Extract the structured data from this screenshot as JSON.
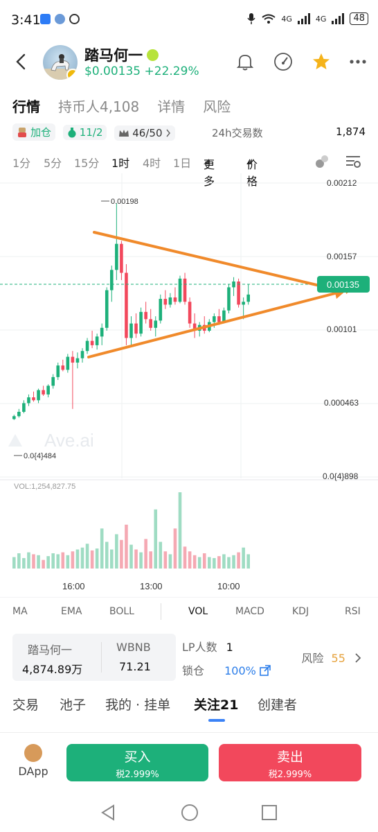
{
  "status_bar": {
    "time": "3:41",
    "network_labels": [
      "4G",
      "4G"
    ],
    "battery": "48"
  },
  "header": {
    "token_name": "踏马何一",
    "price": "$0.00135",
    "change": "+22.29%"
  },
  "tabs": [
    {
      "label": "行情"
    },
    {
      "label": "持币人4,108"
    },
    {
      "label": "详情"
    },
    {
      "label": "风险"
    }
  ],
  "stats": {
    "add_position_label": "加仓",
    "holders_ratio": "11/2",
    "crown_ratio": "46/50",
    "tx_label": "24h交易数",
    "tx_value": "1,874"
  },
  "intervals": {
    "items": [
      "1分",
      "5分",
      "15分",
      "1时",
      "4时",
      "1日"
    ],
    "more_label": "更多",
    "price_label": "价格"
  },
  "chart_data": {
    "type": "candlestick",
    "price_axis_labels": [
      "0.00212",
      "0.00157",
      "0.00101",
      "0.000463",
      "0.0{4}898"
    ],
    "current_price_tag": "0.00135",
    "high_annotation": "0.00198",
    "low_annotation": "0.0{4}484",
    "time_ticks": [
      "16:00",
      "13:00",
      "10:00"
    ],
    "watermark": "Ave.ai",
    "volume_label": "VOL:1,254,827.75",
    "ylim": [
      8.98e-05,
      0.00212
    ],
    "candles": [
      {
        "o": 0.00049,
        "h": 0.00052,
        "l": 0.000484,
        "c": 0.00051
      },
      {
        "o": 0.00051,
        "h": 0.00056,
        "l": 0.0005,
        "c": 0.00054
      },
      {
        "o": 0.00054,
        "h": 0.00062,
        "l": 0.00053,
        "c": 0.0006
      },
      {
        "o": 0.0006,
        "h": 0.00066,
        "l": 0.00058,
        "c": 0.00064
      },
      {
        "o": 0.00064,
        "h": 0.00068,
        "l": 0.00061,
        "c": 0.00062
      },
      {
        "o": 0.00062,
        "h": 0.0007,
        "l": 0.0006,
        "c": 0.00069
      },
      {
        "o": 0.00069,
        "h": 0.00072,
        "l": 0.00065,
        "c": 0.00066
      },
      {
        "o": 0.00066,
        "h": 0.00073,
        "l": 0.00064,
        "c": 0.00072
      },
      {
        "o": 0.00072,
        "h": 0.0008,
        "l": 0.0007,
        "c": 0.00078
      },
      {
        "o": 0.00078,
        "h": 0.00088,
        "l": 0.00076,
        "c": 0.00086
      },
      {
        "o": 0.00086,
        "h": 0.0009,
        "l": 0.00082,
        "c": 0.00083
      },
      {
        "o": 0.00083,
        "h": 0.00094,
        "l": 0.00081,
        "c": 0.00092
      },
      {
        "o": 0.00092,
        "h": 0.00096,
        "l": 0.00056,
        "c": 0.00088
      },
      {
        "o": 0.00088,
        "h": 0.00095,
        "l": 0.00084,
        "c": 0.00091
      },
      {
        "o": 0.00091,
        "h": 0.00098,
        "l": 0.00088,
        "c": 0.00096
      },
      {
        "o": 0.00096,
        "h": 0.00105,
        "l": 0.00094,
        "c": 0.00103
      },
      {
        "o": 0.00103,
        "h": 0.0011,
        "l": 0.00098,
        "c": 0.001
      },
      {
        "o": 0.001,
        "h": 0.00108,
        "l": 0.00097,
        "c": 0.00106
      },
      {
        "o": 0.00106,
        "h": 0.00115,
        "l": 0.001,
        "c": 0.00112
      },
      {
        "o": 0.00112,
        "h": 0.0014,
        "l": 0.0011,
        "c": 0.00138
      },
      {
        "o": 0.00138,
        "h": 0.00155,
        "l": 0.0013,
        "c": 0.00152
      },
      {
        "o": 0.00152,
        "h": 0.00198,
        "l": 0.00145,
        "c": 0.0017
      },
      {
        "o": 0.0017,
        "h": 0.00172,
        "l": 0.00145,
        "c": 0.0015
      },
      {
        "o": 0.0015,
        "h": 0.00156,
        "l": 0.001,
        "c": 0.00105
      },
      {
        "o": 0.00105,
        "h": 0.0012,
        "l": 0.001,
        "c": 0.00115
      },
      {
        "o": 0.00115,
        "h": 0.00122,
        "l": 0.00105,
        "c": 0.00108
      },
      {
        "o": 0.00108,
        "h": 0.00126,
        "l": 0.00106,
        "c": 0.00123
      },
      {
        "o": 0.00123,
        "h": 0.0013,
        "l": 0.00115,
        "c": 0.00118
      },
      {
        "o": 0.00118,
        "h": 0.00125,
        "l": 0.0011,
        "c": 0.00112
      },
      {
        "o": 0.00112,
        "h": 0.0012,
        "l": 0.00106,
        "c": 0.00117
      },
      {
        "o": 0.00117,
        "h": 0.00135,
        "l": 0.00115,
        "c": 0.00132
      },
      {
        "o": 0.00132,
        "h": 0.00138,
        "l": 0.00125,
        "c": 0.00128
      },
      {
        "o": 0.00128,
        "h": 0.00136,
        "l": 0.00126,
        "c": 0.00133
      },
      {
        "o": 0.00133,
        "h": 0.0014,
        "l": 0.00128,
        "c": 0.0013
      },
      {
        "o": 0.0013,
        "h": 0.00148,
        "l": 0.00129,
        "c": 0.00146
      },
      {
        "o": 0.00146,
        "h": 0.0015,
        "l": 0.00128,
        "c": 0.0013
      },
      {
        "o": 0.0013,
        "h": 0.00133,
        "l": 0.00112,
        "c": 0.00115
      },
      {
        "o": 0.00115,
        "h": 0.00122,
        "l": 0.00105,
        "c": 0.0011
      },
      {
        "o": 0.0011,
        "h": 0.00116,
        "l": 0.00106,
        "c": 0.00114
      },
      {
        "o": 0.00114,
        "h": 0.0012,
        "l": 0.00108,
        "c": 0.0011
      },
      {
        "o": 0.0011,
        "h": 0.00118,
        "l": 0.00109,
        "c": 0.00116
      },
      {
        "o": 0.00116,
        "h": 0.00122,
        "l": 0.00112,
        "c": 0.0012
      },
      {
        "o": 0.0012,
        "h": 0.00125,
        "l": 0.00114,
        "c": 0.00116
      },
      {
        "o": 0.00116,
        "h": 0.00126,
        "l": 0.00115,
        "c": 0.00124
      },
      {
        "o": 0.00124,
        "h": 0.00142,
        "l": 0.00122,
        "c": 0.0014
      },
      {
        "o": 0.0014,
        "h": 0.00147,
        "l": 0.00134,
        "c": 0.00144
      },
      {
        "o": 0.00144,
        "h": 0.00146,
        "l": 0.00126,
        "c": 0.00128
      },
      {
        "o": 0.00128,
        "h": 0.00133,
        "l": 0.00118,
        "c": 0.0013
      },
      {
        "o": 0.0013,
        "h": 0.00142,
        "l": 0.00128,
        "c": 0.00135
      }
    ],
    "volumes": [
      120,
      160,
      110,
      170,
      150,
      140,
      90,
      130,
      160,
      150,
      170,
      140,
      180,
      200,
      220,
      260,
      190,
      210,
      420,
      280,
      200,
      360,
      300,
      460,
      250,
      200,
      170,
      310,
      180,
      620,
      280,
      180,
      150,
      420,
      800,
      230,
      180,
      140,
      120,
      160,
      120,
      110,
      130,
      150,
      120,
      140,
      170,
      220,
      150
    ]
  },
  "indicators": {
    "items": [
      "MA",
      "EMA",
      "BOLL",
      "VOL",
      "MACD",
      "KDJ",
      "RSI"
    ]
  },
  "pair_info": {
    "token_name": "踏马何一",
    "token_amount": "4,874.89万",
    "quote_name": "WBNB",
    "quote_amount": "71.21",
    "lp_label": "LP人数",
    "lp_value": "1",
    "lock_label": "锁仓",
    "lock_value": "100%",
    "risk_label": "风险",
    "risk_value": "55"
  },
  "bottom_tabs": [
    {
      "label": "交易"
    },
    {
      "label": "池子"
    },
    {
      "label": "我的 · 挂单"
    },
    {
      "label": "关注21"
    },
    {
      "label": "创建者"
    }
  ],
  "actions": {
    "dapp_label": "DApp",
    "buy_label": "买入",
    "buy_tax": "税2.999%",
    "sell_label": "卖出",
    "sell_tax": "税2.999%"
  },
  "colors": {
    "up": "#1db07a",
    "down": "#f2485c",
    "trend": "#f08a2b",
    "accent": "#3b82f6"
  }
}
